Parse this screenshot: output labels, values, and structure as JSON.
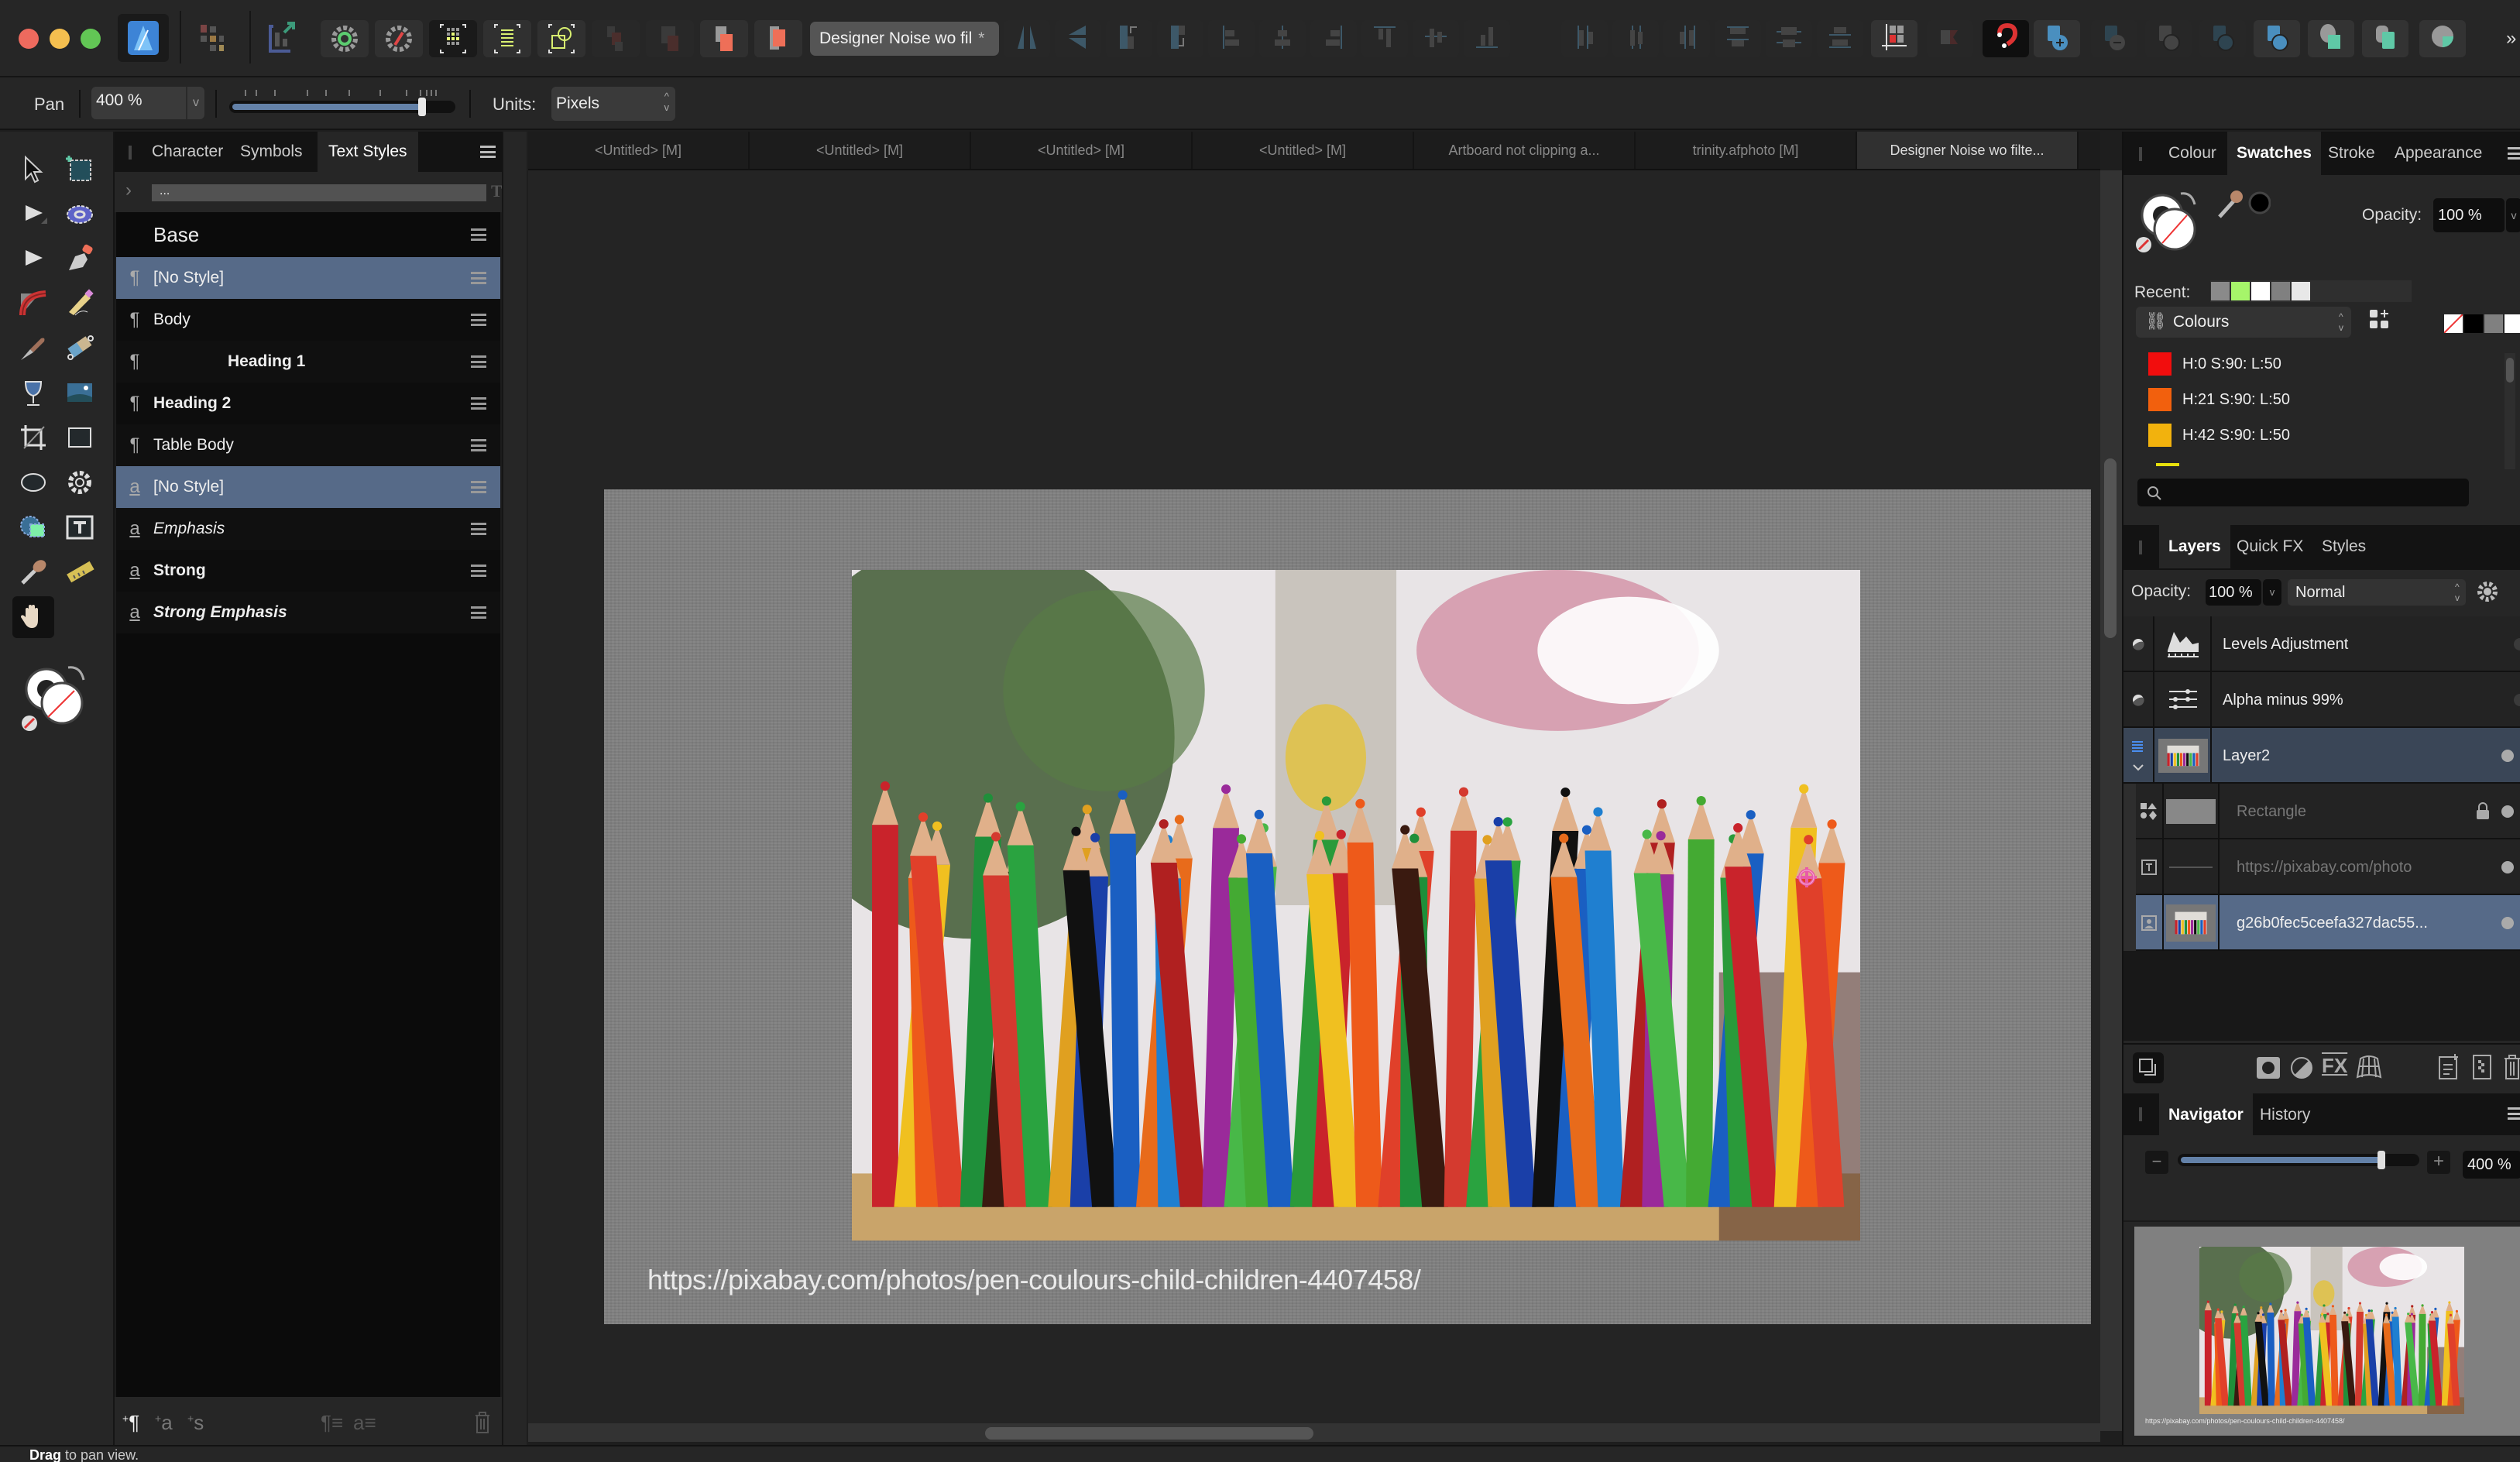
{
  "app": {
    "document_title": "Designer Noise wo fil",
    "document_modified_marker": "*",
    "status_hint_bold": "Drag",
    "status_hint_rest": " to pan view."
  },
  "toolbar": {
    "traffic_lights": [
      "#ee6a5e",
      "#f5bf4f",
      "#62c655"
    ],
    "icons": [
      "affinity-photo-logo-icon",
      "persona-grid-icon",
      "export-persona-icon",
      "settings-green-icon",
      "settings-red-icon",
      "select-all-pixels-icon",
      "selection-marquee-icon",
      "transform-selection-icon",
      "arrange-back-icon",
      "arrange-backward-icon",
      "arrange-forward-icon",
      "arrange-front-icon",
      "flip-horizontal-icon",
      "flip-vertical-icon",
      "rotate-left-icon",
      "rotate-right-icon",
      "align-left-icon",
      "align-center-icon",
      "align-right-icon",
      "align-top-icon",
      "align-middle-icon",
      "align-bottom-icon",
      "distribute-left-icon",
      "distribute-center-icon",
      "distribute-right-icon",
      "distribute-top-icon",
      "distribute-middle-icon",
      "distribute-bottom-icon",
      "snapping-grid-icon",
      "toggle-assistant-icon",
      "snapping-magnet-icon",
      "boolean-add-icon",
      "boolean-subtract-icon",
      "boolean-intersect-icon",
      "boolean-xor-icon",
      "boolean-divide-icon",
      "geometry-merge-icon",
      "geometry-clip-icon",
      "geometry-mask-icon",
      "more-chevron-icon"
    ]
  },
  "context_toolbar": {
    "tool_name": "Pan",
    "zoom_value": "400 %",
    "zoom_slider_fraction": 0.86,
    "units_label": "Units:",
    "units_value": "Pixels"
  },
  "tools": [
    "move-tool-icon",
    "artboard-tool-icon",
    "node-tool-icon",
    "flood-select-tool-icon",
    "point-transform-tool-icon",
    "pen-tool-icon",
    "corner-tool-icon",
    "pencil-tool-icon",
    "paint-brush-tool-icon",
    "erase-brush-tool-icon",
    "fill-tool-icon",
    "place-image-tool-icon",
    "crop-tool-icon",
    "rectangle-tool-icon",
    "ellipse-tool-icon",
    "cog-shape-tool-icon",
    "selection-brush-tool-icon",
    "frame-text-tool-icon",
    "colour-picker-tool-icon",
    "measure-tool-icon",
    "view-tool-icon"
  ],
  "left_panel": {
    "tabs": [
      {
        "label": "Character",
        "active": false
      },
      {
        "label": "Symbols",
        "active": false
      },
      {
        "label": "Text Styles",
        "active": true
      }
    ],
    "search_value": "...",
    "group_label": "Base",
    "styles": [
      {
        "type": "paragraph",
        "glyph": "¶",
        "name": "[No Style]",
        "weight": "normal",
        "italic": false,
        "selected": true,
        "indent": false
      },
      {
        "type": "paragraph",
        "glyph": "¶",
        "name": "Body",
        "weight": "normal",
        "italic": false,
        "selected": false,
        "indent": false
      },
      {
        "type": "paragraph",
        "glyph": "¶",
        "name": "Heading 1",
        "weight": "bold",
        "italic": false,
        "selected": false,
        "indent": true
      },
      {
        "type": "paragraph",
        "glyph": "¶",
        "name": "Heading 2",
        "weight": "bold",
        "italic": false,
        "selected": false,
        "indent": false
      },
      {
        "type": "paragraph",
        "glyph": "¶",
        "name": "Table Body",
        "weight": "normal",
        "italic": false,
        "selected": false,
        "indent": false
      },
      {
        "type": "character",
        "glyph": "a",
        "name": "[No Style]",
        "weight": "normal",
        "italic": false,
        "selected": true,
        "indent": false
      },
      {
        "type": "character",
        "glyph": "a",
        "name": "Emphasis",
        "weight": "normal",
        "italic": true,
        "selected": false,
        "indent": false
      },
      {
        "type": "character",
        "glyph": "a",
        "name": "Strong",
        "weight": "bold",
        "italic": false,
        "selected": false,
        "indent": false
      },
      {
        "type": "character",
        "glyph": "a",
        "name": "Strong Emphasis",
        "weight": "bold",
        "italic": true,
        "selected": false,
        "indent": false
      }
    ],
    "footer_icons": [
      "new-paragraph-style-icon",
      "new-character-style-icon",
      "new-group-style-icon",
      "apply-paragraph-style-icon",
      "apply-character-style-icon",
      "delete-style-icon"
    ]
  },
  "document_tabs": [
    {
      "label": "<Untitled> [M]",
      "active": false
    },
    {
      "label": "<Untitled> [M]",
      "active": false
    },
    {
      "label": "<Untitled> [M]",
      "active": false
    },
    {
      "label": "<Untitled> [M]",
      "active": false
    },
    {
      "label": "Artboard not clipping a...",
      "active": false
    },
    {
      "label": "trinity.afphoto [M]",
      "active": false
    },
    {
      "label": "Designer Noise wo filte...",
      "active": true
    }
  ],
  "canvas": {
    "caption_text": "https://pixabay.com/photos/pen-coulours-child-children-4407458/"
  },
  "swatches_panel": {
    "tabs": [
      {
        "label": "Colour",
        "active": false
      },
      {
        "label": "Swatches",
        "active": true
      },
      {
        "label": "Stroke",
        "active": false
      },
      {
        "label": "Appearance",
        "active": false
      }
    ],
    "opacity_label": "Opacity:",
    "opacity_value": "100 %",
    "recent_label": "Recent:",
    "recent_colors": [
      "#8a8a8a",
      "#a6f56a",
      "#ffffff",
      "#808080",
      "#e8e8e8"
    ],
    "palette_name": "Colours",
    "quick_colors": [
      "none",
      "#000000",
      "#808080",
      "#ffffff"
    ],
    "swatches": [
      {
        "label": "H:0 S:90: L:50",
        "color": "#f20d0d"
      },
      {
        "label": "H:21 S:90: L:50",
        "color": "#f2600d"
      },
      {
        "label": "H:42 S:90: L:50",
        "color": "#f2b20d"
      }
    ],
    "search_placeholder": ""
  },
  "layers_panel": {
    "tabs": [
      {
        "label": "Layers",
        "active": true
      },
      {
        "label": "Quick FX",
        "active": false
      },
      {
        "label": "Styles",
        "active": false
      }
    ],
    "opacity_label": "Opacity:",
    "opacity_value": "100 %",
    "blend_mode": "Normal",
    "layers": [
      {
        "name": "Levels Adjustment",
        "kind": "adjustment",
        "icon": "levels-icon",
        "selected": false,
        "dim": false,
        "child": false,
        "locked": false
      },
      {
        "name": "Alpha minus 99%",
        "kind": "adjustment",
        "icon": "sliders-icon",
        "selected": false,
        "dim": false,
        "child": false,
        "locked": false
      },
      {
        "name": "Layer2",
        "kind": "layer",
        "icon": "layer-thumbnail",
        "selected": true,
        "dim": false,
        "child": false,
        "locked": false,
        "expanded": true
      },
      {
        "name": "Rectangle",
        "kind": "shape",
        "icon": "shape-icon",
        "selected": false,
        "dim": true,
        "child": true,
        "locked": true
      },
      {
        "name": "https://pixabay.com/photo",
        "kind": "text",
        "icon": "text-frame-icon",
        "selected": false,
        "dim": true,
        "child": true,
        "locked": false
      },
      {
        "name": "g26b0fec5ceefa327dac55...",
        "kind": "image",
        "icon": "image-icon",
        "selected": true,
        "dim": false,
        "child": true,
        "locked": false
      }
    ],
    "footer_icons": [
      "layer-stack-icon",
      "mask-layer-icon",
      "adjustments-icon",
      "fx-icon",
      "live-filter-icon",
      "add-pixel-layer-icon",
      "add-group-icon",
      "delete-layer-icon"
    ]
  },
  "navigator_panel": {
    "tabs": [
      {
        "label": "Navigator",
        "active": true
      },
      {
        "label": "History",
        "active": false
      }
    ],
    "zoom_value": "400 %",
    "zoom_slider_fraction": 0.86,
    "preview_caption": "https://pixabay.com/photos/pen-coulours-child-children-4407458/"
  }
}
